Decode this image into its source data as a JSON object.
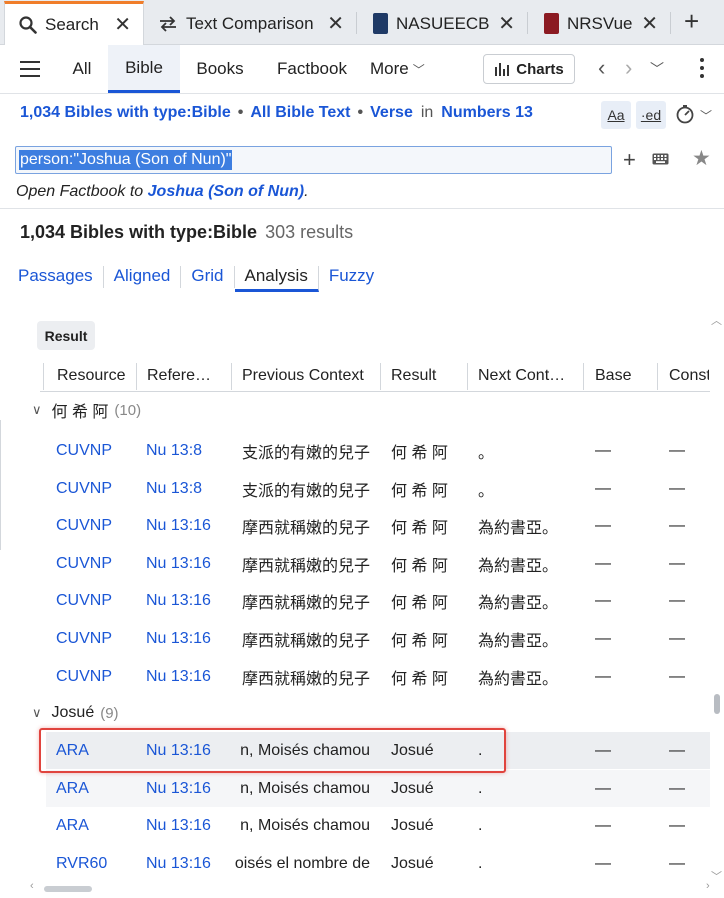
{
  "tabs": [
    {
      "label": "Search",
      "icon": "search-icon"
    },
    {
      "label": "Text Comparison",
      "icon": "compare-icon"
    },
    {
      "label": "NASUEECB",
      "icon": "book-icon",
      "color": "#1f3a66"
    },
    {
      "label": "NRSVue",
      "icon": "book-icon",
      "color": "#8b1a22"
    }
  ],
  "toolbar": {
    "nav": [
      "All",
      "Bible",
      "Books",
      "Factbook",
      "More"
    ],
    "active_nav": "Bible",
    "charts_label": "Charts"
  },
  "query": {
    "bibles": "1,034 Bibles with type:Bible",
    "scope": "All Bible Text",
    "unit": "Verse",
    "in_word": "in",
    "range": "Numbers 13",
    "font_btn": "Aa",
    "ed_btn": "·ed"
  },
  "search": {
    "value": "person:\"Joshua (Son of Nun)\""
  },
  "factbook": {
    "prefix": "Open Factbook to ",
    "link": "Joshua (Son of Nun)",
    "suffix": "."
  },
  "results": {
    "title": "1,034 Bibles with type:Bible",
    "count": "303 results"
  },
  "view_tabs": [
    "Passages",
    "Aligned",
    "Grid",
    "Analysis",
    "Fuzzy"
  ],
  "active_view": "Analysis",
  "table": {
    "group_chip": "Result",
    "columns": [
      "Resource",
      "Refere…",
      "Previous Context",
      "Result",
      "Next Cont…",
      "Base",
      "Const"
    ],
    "groups": [
      {
        "name": "何 希 阿",
        "count": "(10)",
        "rows": [
          {
            "resource": "CUVNP",
            "ref": "Nu 13:8",
            "prev": "支派的有嫩的兒子",
            "result": "何 希 阿",
            "next": "。",
            "base": "—",
            "const": "—"
          },
          {
            "resource": "CUVNP",
            "ref": "Nu 13:8",
            "prev": "支派的有嫩的兒子",
            "result": "何 希 阿",
            "next": "。",
            "base": "—",
            "const": "—"
          },
          {
            "resource": "CUVNP",
            "ref": "Nu 13:16",
            "prev": "摩西就稱嫩的兒子",
            "result": "何 希 阿",
            "next": "為約書亞。",
            "base": "—",
            "const": "—"
          },
          {
            "resource": "CUVNP",
            "ref": "Nu 13:16",
            "prev": "摩西就稱嫩的兒子",
            "result": "何 希 阿",
            "next": "為約書亞。",
            "base": "—",
            "const": "—"
          },
          {
            "resource": "CUVNP",
            "ref": "Nu 13:16",
            "prev": "摩西就稱嫩的兒子",
            "result": "何 希 阿",
            "next": "為約書亞。",
            "base": "—",
            "const": "—"
          },
          {
            "resource": "CUVNP",
            "ref": "Nu 13:16",
            "prev": "摩西就稱嫩的兒子",
            "result": "何 希 阿",
            "next": "為約書亞。",
            "base": "—",
            "const": "—"
          },
          {
            "resource": "CUVNP",
            "ref": "Nu 13:16",
            "prev": "摩西就稱嫩的兒子",
            "result": "何 希 阿",
            "next": "為約書亞。",
            "base": "—",
            "const": "—"
          }
        ]
      },
      {
        "name": "Josué",
        "count": "(9)",
        "rows": [
          {
            "resource": "ARA",
            "ref": "Nu 13:16",
            "prev": "n, Moisés chamou",
            "result": "Josué",
            "next": ".",
            "base": "—",
            "const": "—"
          },
          {
            "resource": "ARA",
            "ref": "Nu 13:16",
            "prev": "n, Moisés chamou",
            "result": "Josué",
            "next": ".",
            "base": "—",
            "const": "—"
          },
          {
            "resource": "ARA",
            "ref": "Nu 13:16",
            "prev": "n, Moisés chamou",
            "result": "Josué",
            "next": ".",
            "base": "—",
            "const": "—"
          },
          {
            "resource": "RVR60",
            "ref": "Nu 13:16",
            "prev": "oisés el nombre de",
            "result": "Josué",
            "next": ".",
            "base": "—",
            "const": "—"
          }
        ]
      }
    ]
  },
  "colors": {
    "link": "#1a56d6",
    "active_tab_accent": "#f07d2a",
    "highlight": "#e0443e"
  }
}
